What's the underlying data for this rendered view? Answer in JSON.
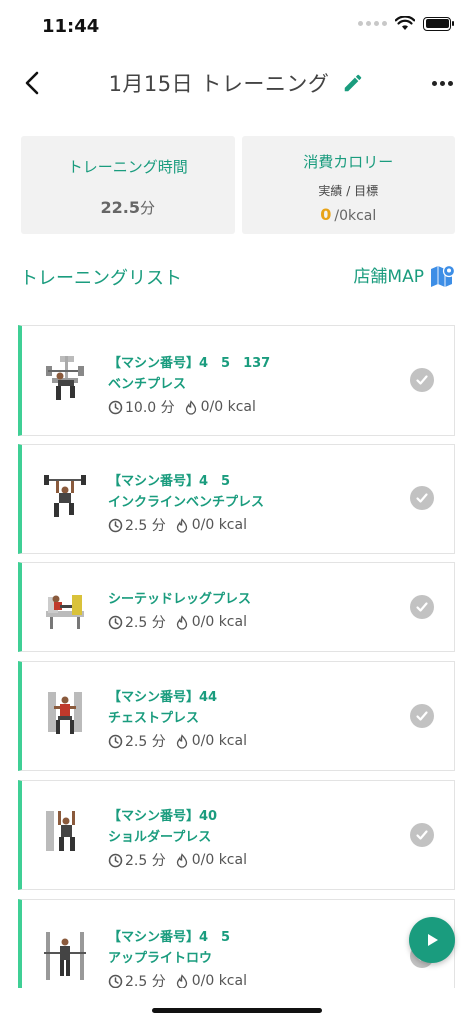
{
  "status_bar": {
    "time": "11:44"
  },
  "header": {
    "title": "1月15日 トレーニング"
  },
  "summary": {
    "time_card": {
      "title": "トレーニング時間",
      "value": "22.5",
      "unit": "分"
    },
    "calorie_card": {
      "title": "消費カロリー",
      "subtitle": "実績 / 目標",
      "actual": "0",
      "target": "/0kcal"
    }
  },
  "training_list": {
    "title": "トレーニングリスト",
    "map_label": "店舗MAP"
  },
  "items": [
    {
      "line1": "【マシン番号】4　5　137",
      "line2": "ベンチプレス",
      "duration": "10.0 分",
      "calories": "0/0 kcal",
      "icon": "bench-press-thumbnail"
    },
    {
      "line1": "【マシン番号】4　5",
      "line2": "インクラインベンチプレス",
      "duration": "2.5 分",
      "calories": "0/0 kcal",
      "icon": "incline-bench-press-thumbnail"
    },
    {
      "line1": "シーテッドレッグプレス",
      "line2": "",
      "duration": "2.5 分",
      "calories": "0/0 kcal",
      "icon": "seated-leg-press-thumbnail"
    },
    {
      "line1": "【マシン番号】44",
      "line2": "チェストプレス",
      "duration": "2.5 分",
      "calories": "0/0 kcal",
      "icon": "chest-press-thumbnail"
    },
    {
      "line1": "【マシン番号】40",
      "line2": "ショルダープレス",
      "duration": "2.5 分",
      "calories": "0/0 kcal",
      "icon": "shoulder-press-thumbnail"
    },
    {
      "line1": "【マシン番号】4　5",
      "line2": "アップライトロウ",
      "duration": "2.5 分",
      "calories": "0/0 kcal",
      "icon": "upright-row-thumbnail"
    }
  ],
  "colors": {
    "accent": "#1a9c7e",
    "bar": "#3fcf95",
    "calorie": "#e8a317",
    "check": "#c2c2c2"
  }
}
